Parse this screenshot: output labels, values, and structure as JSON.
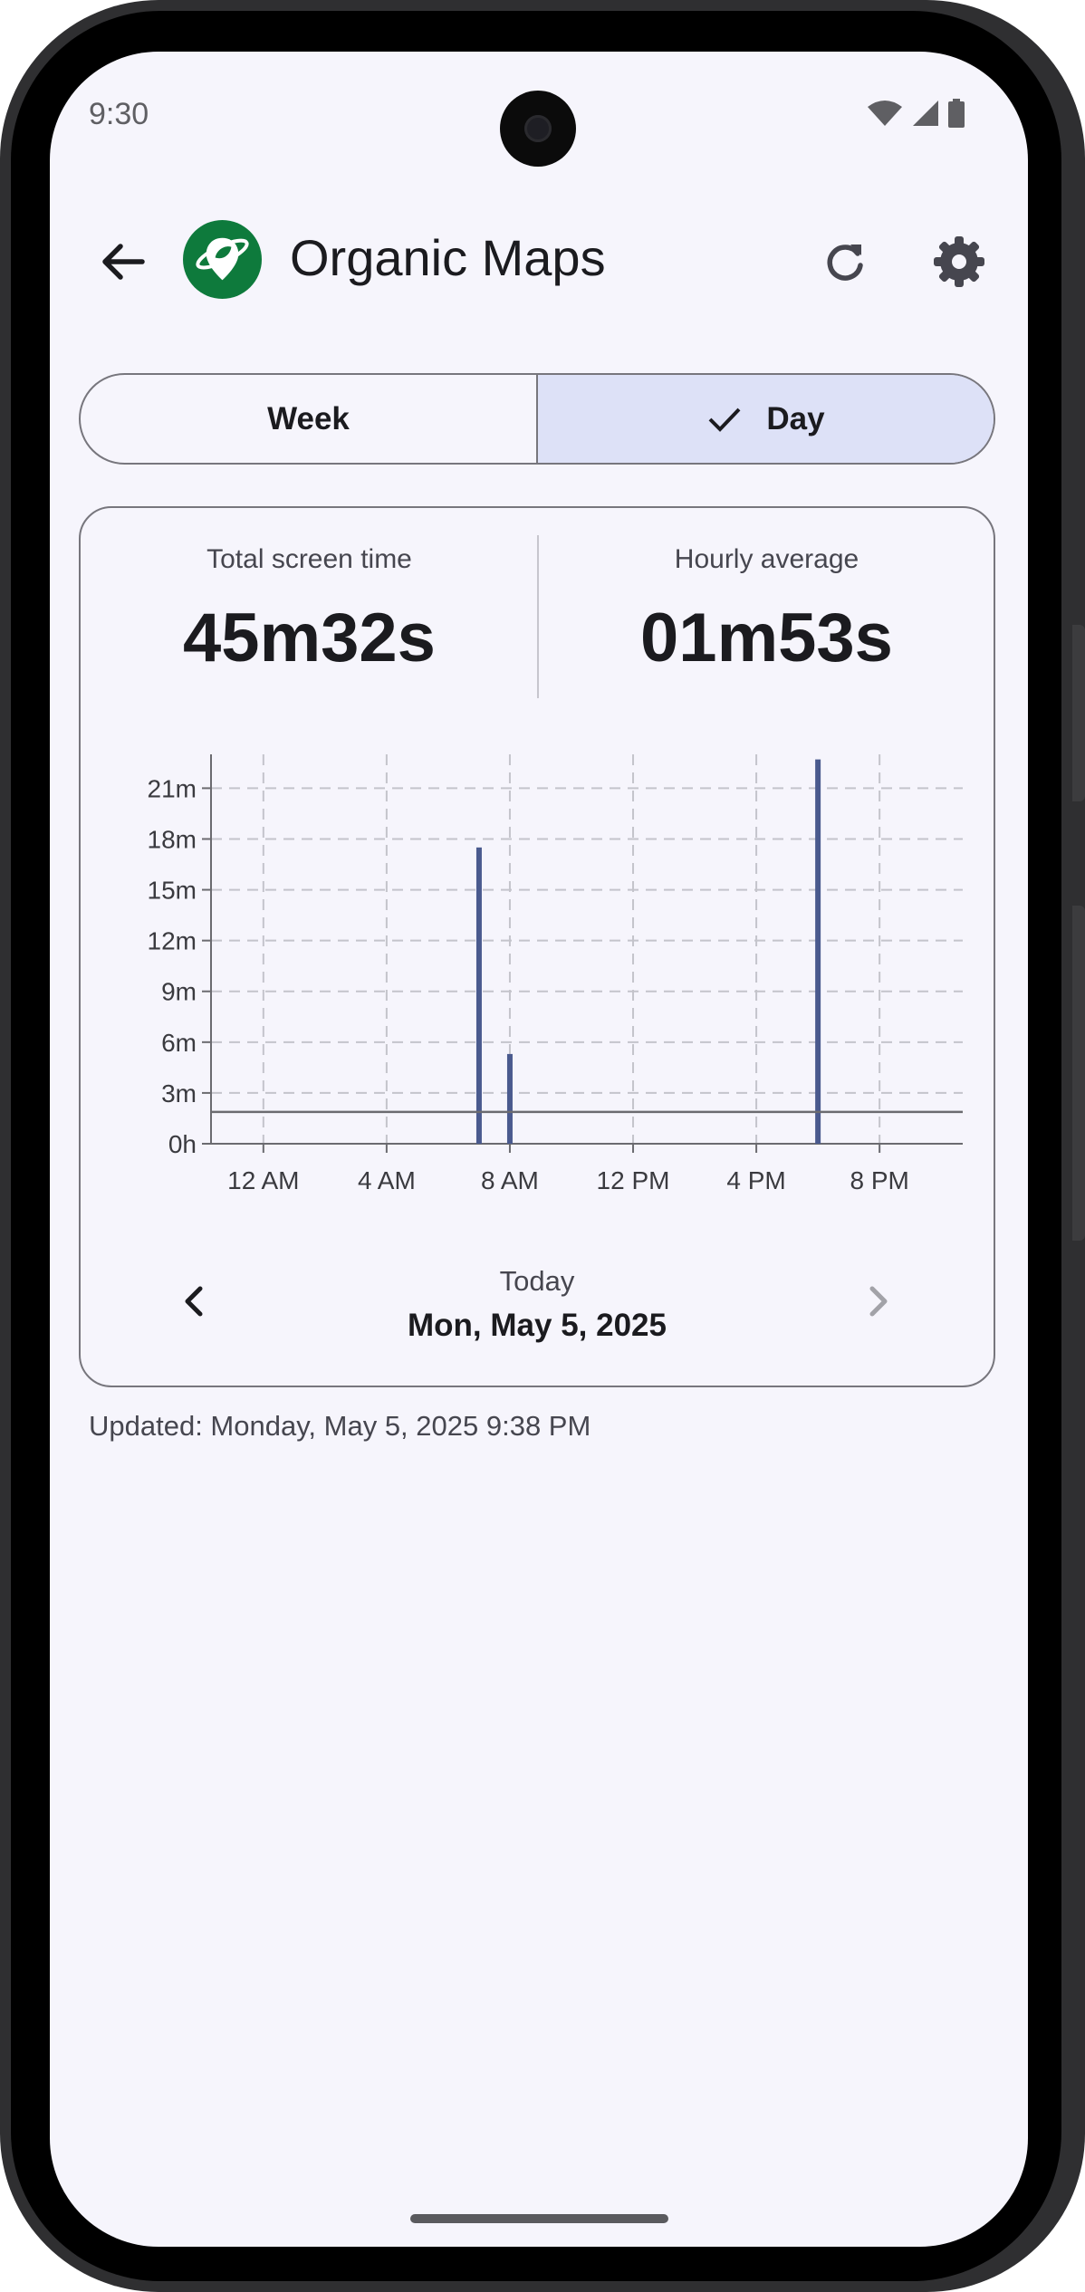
{
  "status_bar": {
    "time": "9:30"
  },
  "app_bar": {
    "app_name": "Organic Maps",
    "icons": [
      "back-arrow-icon",
      "organic-maps-logo",
      "refresh-icon",
      "gear-icon"
    ]
  },
  "segmented": {
    "week_label": "Week",
    "day_label": "Day",
    "selected": "Day"
  },
  "summary": {
    "total_label": "Total screen time",
    "total_value": "45m32s",
    "average_label": "Hourly average",
    "average_value": "01m53s"
  },
  "chart_data": {
    "type": "bar",
    "x_tick_labels": [
      "12 AM",
      "4 AM",
      "8 AM",
      "12 PM",
      "4 PM",
      "8 PM"
    ],
    "y_tick_labels": [
      "0h",
      "3m",
      "6m",
      "9m",
      "12m",
      "15m",
      "18m",
      "21m"
    ],
    "y_ticks_minutes": [
      0,
      3,
      6,
      9,
      12,
      15,
      18,
      21
    ],
    "ylim_minutes": [
      0,
      23
    ],
    "xlim_hours": [
      -1.7,
      22.7
    ],
    "average_line_minutes": 1.88,
    "bars": [
      {
        "hour": 7,
        "minutes": 17.5
      },
      {
        "hour": 8,
        "minutes": 5.3
      },
      {
        "hour": 18,
        "minutes": 22.7
      }
    ],
    "grid": true,
    "bar_color": "#4a5a8e"
  },
  "date_nav": {
    "relative": "Today",
    "date": "Mon, May 5, 2025"
  },
  "footer": {
    "updated": "Updated: Monday, May 5, 2025 9:38 PM"
  }
}
